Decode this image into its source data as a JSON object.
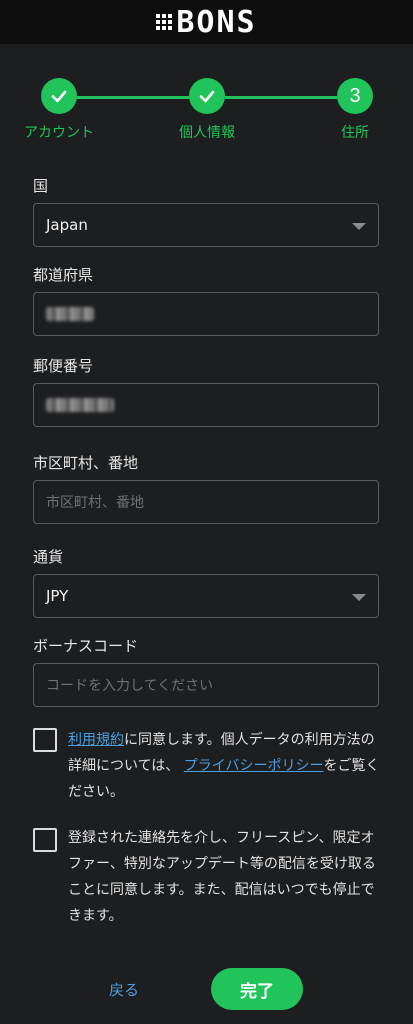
{
  "brand": {
    "logo_text": "BONS"
  },
  "stepper": {
    "steps": [
      {
        "label": "アカウント",
        "state": "done"
      },
      {
        "label": "個人情報",
        "state": "done"
      },
      {
        "label": "住所",
        "state": "current",
        "number": "3"
      }
    ],
    "accent": "#21c45a"
  },
  "form": {
    "country": {
      "label": "国",
      "value": "Japan"
    },
    "prefecture": {
      "label": "都道府県",
      "value_redacted": true
    },
    "postal_code": {
      "label": "郵便番号",
      "value_redacted": true
    },
    "address": {
      "label": "市区町村、番地",
      "placeholder": "市区町村、番地"
    },
    "currency": {
      "label": "通貨",
      "value": "JPY"
    },
    "bonus_code": {
      "label": "ボーナスコード",
      "placeholder": "コードを入力してください"
    }
  },
  "consents": {
    "terms": {
      "link_terms": "利用規約",
      "text_1": "に同意します。個人データの利用方法の詳細については、",
      "link_privacy": "プライバシーポリシー",
      "text_2": "をご覧ください。",
      "checked": false
    },
    "marketing": {
      "text": "登録された連絡先を介し、フリースピン、限定オファー、特別なアップデート等の配信を受け取ることに同意します。また、配信はいつでも停止できます。",
      "checked": false
    }
  },
  "actions": {
    "back_label": "戻る",
    "finish_label": "完了"
  }
}
